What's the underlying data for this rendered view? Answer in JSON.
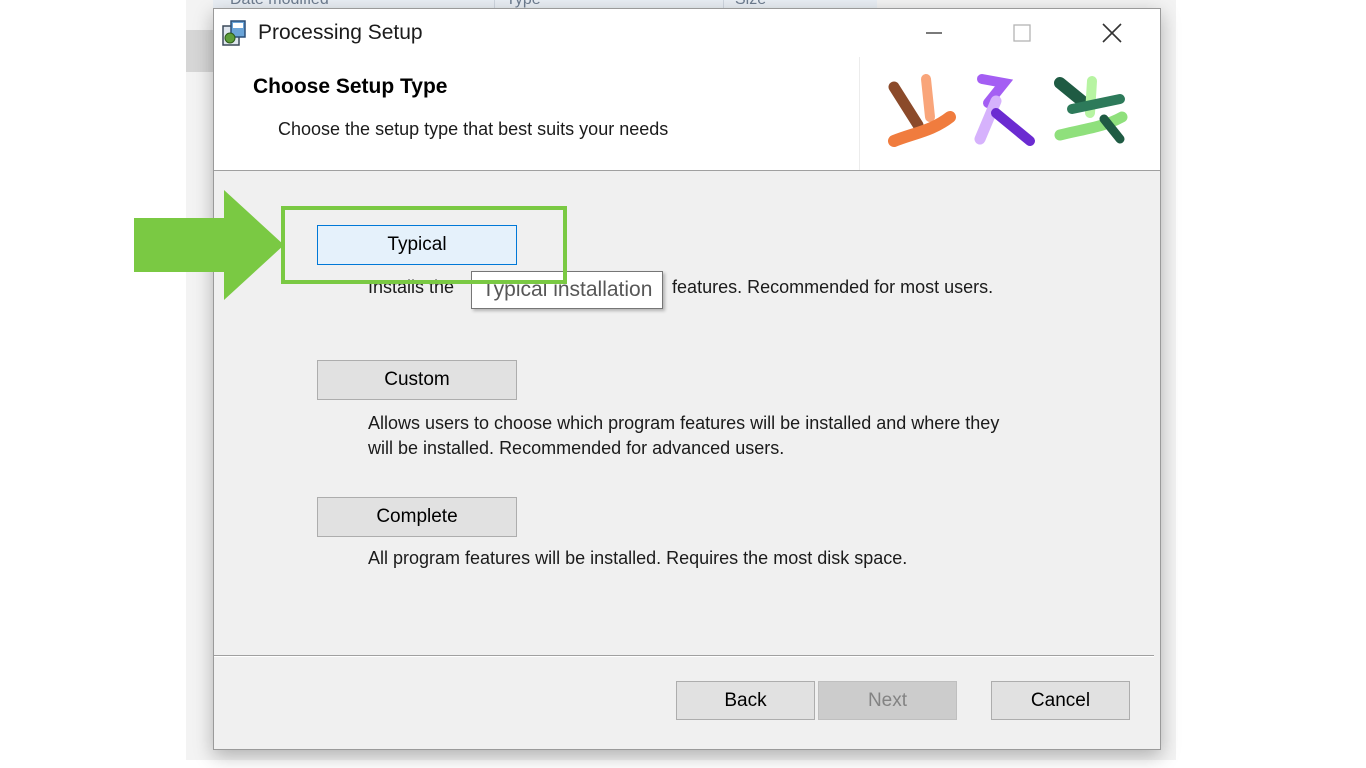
{
  "background_window": {
    "columns": [
      "Date modified",
      "Type",
      "Size"
    ]
  },
  "window": {
    "title": "Processing Setup",
    "icon": "installer-icon",
    "controls": [
      "minimize-icon",
      "maximize-icon",
      "close-icon"
    ]
  },
  "header": {
    "title": "Choose Setup Type",
    "subtitle": "Choose the setup type that best suits your needs",
    "logo": "processing-logo"
  },
  "options": [
    {
      "label": "Typical",
      "description": "Installs the most common program features. Recommended for most users.",
      "visible_prefix": "Installs the",
      "visible_suffix": "features. Recommended for most users.",
      "focused": true
    },
    {
      "label": "Custom",
      "description_line1": "Allows users to choose which program features will be installed and where they",
      "description_line2": "will be installed. Recommended for advanced users."
    },
    {
      "label": "Complete",
      "description": "All program features will be installed. Requires the most disk space."
    }
  ],
  "tooltip": "Typical installation",
  "footer": {
    "back": "Back",
    "next": "Next",
    "cancel": "Cancel",
    "next_enabled": false
  },
  "annotation": {
    "color": "#7ac943",
    "shape": "arrow-and-box"
  }
}
